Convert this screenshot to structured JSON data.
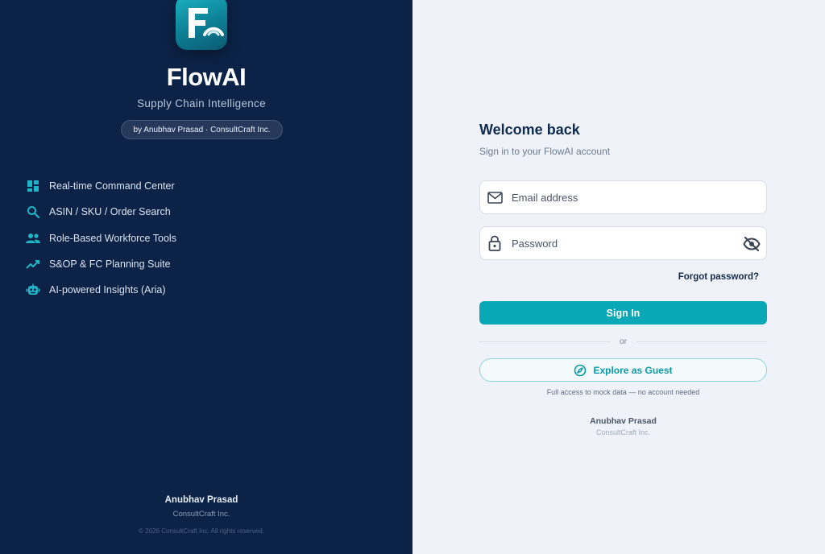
{
  "brand": {
    "logo_letter": "F",
    "name": "FlowAI",
    "tagline": "Supply Chain Intelligence",
    "byline": "by Anubhav Prasad · ConsultCraft Inc."
  },
  "features": [
    {
      "icon": "dashboard-icon",
      "label": "Real-time Command Center"
    },
    {
      "icon": "search-icon",
      "label": "ASIN / SKU / Order Search"
    },
    {
      "icon": "people-icon",
      "label": "Role-Based Workforce Tools"
    },
    {
      "icon": "trending-up-icon",
      "label": "S&OP & FC Planning Suite"
    },
    {
      "icon": "robot-icon",
      "label": "AI-powered Insights (Aria)"
    }
  ],
  "left_footer": {
    "name": "Anubhav Prasad",
    "company": "ConsultCraft Inc.",
    "copyright": "© 2026 ConsultCraft Inc. All rights reserved."
  },
  "login": {
    "title": "Welcome back",
    "subtitle": "Sign in to your FlowAI account",
    "email_placeholder": "Email address",
    "email_value": "",
    "password_placeholder": "Password",
    "password_value": "",
    "forgot_label": "Forgot password?",
    "signin_label": "Sign In",
    "divider_label": "or",
    "guest_label": "Explore as Guest",
    "guest_note": "Full access to mock data — no account needed",
    "footer_name": "Anubhav Prasad",
    "footer_company": "ConsultCraft Inc."
  },
  "colors": {
    "left_bg": "#0c2347",
    "right_bg": "#eff3f9",
    "accent": "#08a8b6",
    "icon_accent": "#1fb4c6"
  }
}
